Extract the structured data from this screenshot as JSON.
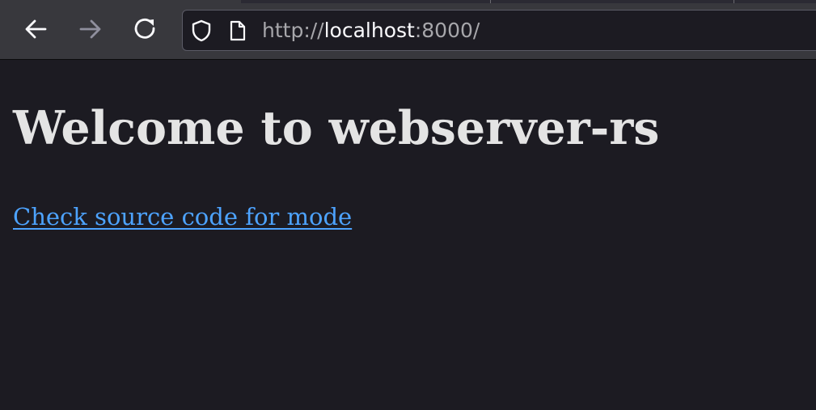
{
  "browser": {
    "url_scheme": "http://",
    "url_host": "localhost",
    "url_port_path": ":8000/"
  },
  "icons": {
    "back": "arrow-left-icon",
    "forward": "arrow-right-icon",
    "reload": "reload-icon",
    "tracking_protection": "shield-icon",
    "page_info": "page-icon"
  },
  "colors": {
    "chrome_bg": "#38383d",
    "page_bg": "#1c1b22",
    "title_text": "#e4e4e4",
    "link": "#4da3ff"
  },
  "page": {
    "title": "Welcome to webserver-rs",
    "link_text": "Check source code for mode"
  }
}
